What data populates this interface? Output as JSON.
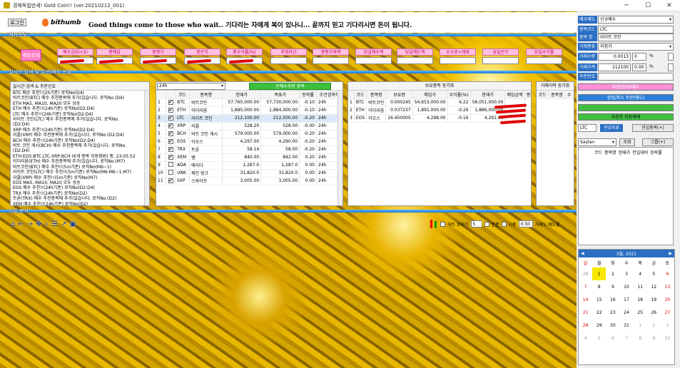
{
  "window": {
    "title": "경제독립만세! Gold Coin!! (ver.20210212_001)"
  },
  "header": {
    "login_label": "로그인",
    "brand": "bithumb",
    "slogan": "Good things come to those who wait..  기다리는 자에게 복이 있나니...  끝까지 믿고 기다리시면 돈이 됩니다."
  },
  "sections": {
    "account": "계좌정보",
    "realtime": "실시간 검색 및 주문/매도 현황",
    "chart": "차트 분석"
  },
  "account_labels": [
    "예수금(D+2)",
    "총매입",
    "총평가",
    "총손익",
    "총수익률(%)",
    "추정자산",
    "총평가세액",
    "당일매수액",
    "당일매도액",
    "수수료+제세",
    "당일손익",
    "당일수익률"
  ],
  "account_button": "계좌조회",
  "signal_panel": {
    "title": "실시간 검색 & 주문신호",
    "lines": [
      "BTC 매수 추천!!(2h기준) 로직No(D4)",
      "비트코인(BTC) 매수 추천종목에 추가(있습니다. 로직No.(D4)",
      "ETH MA5, MA10, MA20 모두 상승",
      "ETH 매수 추천!!(24h기준) 로직No(D2:D4)",
      "LTC 매수 추천!!(24h기준) 로직No(D2:D4)",
      "라이트 코인(LTC) 매수 추천종목에 추가(있습니다. 로직No.",
      "(D2:D4)",
      "XRP 매수 추천!!(24h기준) 로직No(D2:D4)",
      "리플(XRP) 매수 추천종목에 추가(있습니다. 로직No.(D2:D4)",
      "BCH 매수 추천!!(24h기준) 로직No(D2:D4)",
      "비트 코인 캐시(BCH) 매수 추천종목에 추가(있습니다. 로직No.",
      "(D2:D4)",
      "ETH:EOS:BTC:LTC:XRP:BCH (6개 종목 자동화원) 중, 23:05:52",
      "이더리움(ETH) 매수 추천종목에 추가(있습니다. 로직No.(M7)",
      "비트코인(BTC) 매수 추천!!(5m기준) 로직No(M6~1)",
      "라이트 코인(LTC) 매수 추천!!(5m기준) 로직No(M6:M6~1:M7)",
      "리플(XRP) 매수 추천!!(5m기준) 로직No(M7)",
      "EOS MA5, MA10, MA20 모두 상승",
      "EOS 매수 추천!!(24h기준) 로직No(D2:D4)",
      "TRX 매수 추천!!(24h기준) 로직No(D2)",
      "트론(TRX) 매수 추천종목에 추가(있습니다. 로직No.(D2)",
      "XEM 매수 추천!!(24h기준) 로직No(D2)"
    ]
  },
  "market": {
    "period": "24h",
    "auto_button": "전체수추천 종목",
    "headers": [
      "",
      "",
      "코드",
      "종목명",
      "현재가",
      "목표가",
      "등락률",
      "조건검색식"
    ],
    "rows": [
      [
        "1",
        "✔",
        "BTC",
        "비트코인",
        "57,765,000.00",
        "57,730,000.00",
        "-0.10",
        "24h"
      ],
      [
        "2",
        "✔",
        "ETH",
        "이더리움",
        "1,885,000.00",
        "1,884,000.00",
        "-0.10",
        "24h"
      ],
      [
        "3",
        "✔",
        "LTC",
        "라이트 코인",
        "212,100.00",
        "212,500.00",
        "-0.20",
        "24h"
      ],
      [
        "4",
        "✔",
        "XRP",
        "리플",
        "528.20",
        "528.00",
        "-0.00",
        "24h"
      ],
      [
        "5",
        "✔",
        "BCH",
        "비트 코인 캐시",
        "579,000.00",
        "579,000.00",
        "-0.20",
        "24h"
      ],
      [
        "6",
        "✔",
        "EOS",
        "이오스",
        "4,297.00",
        "4,290.00",
        "-0.20",
        "24h"
      ],
      [
        "7",
        "✔",
        "TRX",
        "트론",
        "58.14",
        "58.00",
        "-0.20",
        "24h"
      ],
      [
        "8",
        "✔",
        "XEM",
        "뱀",
        "840.00",
        "842.00",
        "0.20",
        "24h"
      ],
      [
        "9",
        "",
        "ADA",
        "에이다",
        "1,287.0",
        "1,287.0",
        "0.00",
        "24h"
      ],
      [
        "10",
        "",
        "UNK",
        "체인 링크",
        "31,820.0",
        "31,820.0",
        "0.00",
        "24h"
      ],
      [
        "11",
        "✔",
        "SXP",
        "스와이프",
        "3,005.00",
        "3,005.00",
        "0.00",
        "24h"
      ]
    ]
  },
  "holdings": {
    "title": "보유종목 동기화",
    "headers": [
      "",
      "코드",
      "종목명",
      "보유량",
      "매입가",
      "수익률(%)",
      "현재가",
      "매입금액",
      "평가금"
    ],
    "rows": [
      [
        "1",
        "BTC",
        "비트코인",
        "0.000245",
        "54,653,000.00",
        "6.22",
        "58,051,000.00",
        "",
        ""
      ],
      [
        "2",
        "ETH",
        "이더리움",
        "0.037237",
        "1,891,000.00",
        "-0.26",
        "1,886,000.00",
        "",
        ""
      ],
      [
        "3",
        "EOS",
        "이오스",
        "16.450005",
        "4,298.00",
        "-0.16",
        "4,291.00",
        "",
        ""
      ]
    ]
  },
  "trade_history": {
    "title": "거래이력 동기화",
    "headers": [
      "코드",
      "종목명",
      "수"
    ]
  },
  "chart_toolbar": {
    "icons": [
      "home-icon",
      "back-icon",
      "forward-icon",
      "pan-icon",
      "zoom-icon",
      "configure-icon",
      "lines-icon",
      "save-icon"
    ],
    "chart_label": "차트 보이기",
    "qty_value": "5",
    "minute_label": "분봉",
    "hour_label": "시봉",
    "ratio_value": "0.50",
    "ratio_label": "거래도 매도율"
  },
  "order_panel": {
    "order_type_label": "매수매도",
    "order_type_value": "신규매수",
    "code_label": "종목코드",
    "code_value": "LTC",
    "name_label": "종목 명",
    "name_value": "라이트 코인",
    "trade_type_label": "거래종류",
    "trade_type_value": "지정가",
    "qty_label": "거래수량",
    "qty_value": "0.0013",
    "qty_pct": "0",
    "price_label": "거래가격",
    "price_value": "212100",
    "price_pct": "0.00",
    "order_no_label": "주문번호",
    "order_no_value": "",
    "pct_sign": "%",
    "btn_buy": "주문(신규)매수",
    "btn_sell": "정정/취소 주문(매도)",
    "btn_extra": "",
    "btn_rec": "추천주 자동매매",
    "watch_code": "LTC",
    "watch_btn": "관심지표",
    "watch_add": "관심종목(+)",
    "group_select": "Saylan",
    "group_query": "조회",
    "group_btn": "그룹(+)",
    "list_headers": [
      "코드",
      "종목명",
      "현재가",
      "전일대비",
      "등락률"
    ]
  },
  "calendar": {
    "header": "3월,  2021",
    "dow": [
      "일",
      "월",
      "화",
      "수",
      "목",
      "금",
      "토"
    ],
    "weeks": [
      [
        "28",
        "1",
        "2",
        "3",
        "4",
        "5",
        "6"
      ],
      [
        "7",
        "8",
        "9",
        "10",
        "11",
        "12",
        "13"
      ],
      [
        "14",
        "15",
        "16",
        "17",
        "18",
        "19",
        "20"
      ],
      [
        "21",
        "22",
        "23",
        "24",
        "25",
        "26",
        "27"
      ],
      [
        "28",
        "29",
        "30",
        "31",
        "1",
        "2",
        "3"
      ],
      [
        "4",
        "5",
        "6",
        "7",
        "8",
        "9",
        "10"
      ]
    ]
  }
}
